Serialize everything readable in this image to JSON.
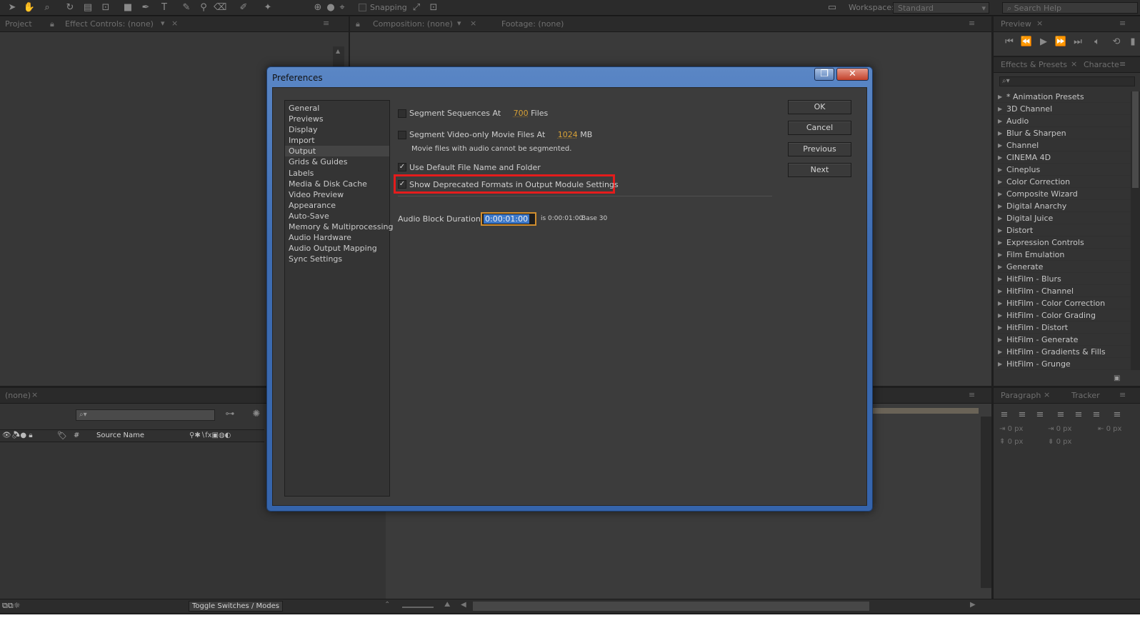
{
  "toolbar": {
    "snapping_label": "Snapping",
    "workspace_label": "Workspace:",
    "workspace_value": "Standard",
    "search_placeholder": "Search Help"
  },
  "panels": {
    "project_tab": "Project",
    "effect_controls_tab": "Effect Controls: (none)",
    "composition_tab": "Composition: (none)",
    "footage_tab": "Footage: (none)",
    "preview_tab": "Preview",
    "effects_presets_tab": "Effects & Presets",
    "character_tab": "Characte",
    "paragraph_tab": "Paragraph",
    "tracker_tab": "Tracker",
    "timeline_tab": "(none)"
  },
  "effects_list": [
    "* Animation Presets",
    "3D Channel",
    "Audio",
    "Blur & Sharpen",
    "Channel",
    "CINEMA 4D",
    "Cineplus",
    "Color Correction",
    "Composite Wizard",
    "Digital Anarchy",
    "Digital Juice",
    "Distort",
    "Expression Controls",
    "Film Emulation",
    "Generate",
    "HitFilm - Blurs",
    "HitFilm - Channel",
    "HitFilm - Color Correction",
    "HitFilm - Color Grading",
    "HitFilm - Distort",
    "HitFilm - Generate",
    "HitFilm - Gradients & Fills",
    "HitFilm - Grunge"
  ],
  "paragraph": {
    "indent_left": "0 px",
    "indent_first": "0 px",
    "indent_right": "0 px",
    "space_before": "0 px",
    "space_after": "0 px"
  },
  "timeline": {
    "source_name_header": "Source Name",
    "hash_header": "#",
    "toggle_switches": "Toggle Switches / Modes"
  },
  "dialog": {
    "title": "Preferences",
    "categories": [
      "General",
      "Previews",
      "Display",
      "Import",
      "Output",
      "Grids & Guides",
      "Labels",
      "Media & Disk Cache",
      "Video Preview",
      "Appearance",
      "Auto-Save",
      "Memory & Multiprocessing",
      "Audio Hardware",
      "Audio Output Mapping",
      "Sync Settings"
    ],
    "selected_category": "Output",
    "segment_sequences": {
      "label": "Segment Sequences At",
      "value": "700",
      "unit": "Files",
      "checked": false
    },
    "segment_video": {
      "label": "Segment Video-only Movie Files At",
      "value": "1024",
      "unit": "MB",
      "checked": false
    },
    "segment_note": "Movie files with audio cannot be segmented.",
    "use_default": {
      "label": "Use Default File Name and Folder",
      "checked": true
    },
    "show_deprecated": {
      "label": "Show Deprecated Formats in Output Module Settings",
      "checked": true
    },
    "audio_block": {
      "label": "Audio Block Duration:",
      "value": "0:00:01:00",
      "is_text": "is 0:00:01:00",
      "base_text": "Base 30"
    },
    "buttons": {
      "ok": "OK",
      "cancel": "Cancel",
      "previous": "Previous",
      "next": "Next"
    },
    "check_glyph": "✓",
    "highlight_color": "#e41c1c"
  }
}
